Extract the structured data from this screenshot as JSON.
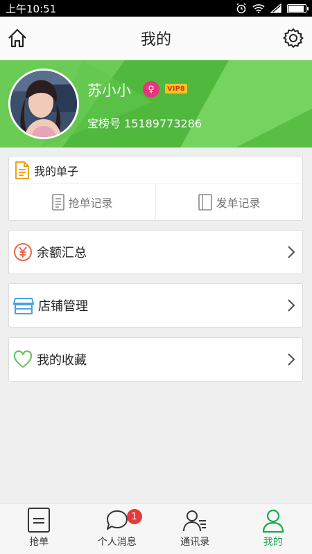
{
  "status_bar": {
    "time": "上午10:51"
  },
  "header": {
    "title": "我的"
  },
  "profile": {
    "name": "苏小小",
    "gender_symbol": "♀",
    "vip_label": "VIP8",
    "account_id": "宝榜号 15189773286"
  },
  "orders": {
    "title": "我的单子",
    "actions": [
      {
        "label": "抢单记录"
      },
      {
        "label": "发单记录"
      }
    ]
  },
  "menu": [
    {
      "label": "余额汇总",
      "icon": "yuan-icon"
    },
    {
      "label": "店铺管理",
      "icon": "store-icon"
    },
    {
      "label": "我的收藏",
      "icon": "heart-icon"
    }
  ],
  "bottom_nav": {
    "items": [
      {
        "label": "抢单",
        "icon": "list-icon"
      },
      {
        "label": "个人消息",
        "icon": "chat-icon",
        "badge": "1"
      },
      {
        "label": "通讯录",
        "icon": "contacts-icon"
      },
      {
        "label": "我的",
        "icon": "user-icon",
        "active": true
      }
    ]
  },
  "colors": {
    "accent": "#1aa84b",
    "banner": "#5fc44b",
    "badge": "#e23b3b"
  }
}
